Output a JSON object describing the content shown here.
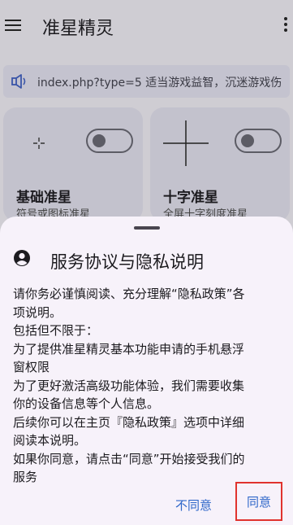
{
  "appbar": {
    "title": "准星精灵"
  },
  "banner": {
    "text": "index.php?type=5 适当游戏益智，沉迷游戏伤"
  },
  "cards": [
    {
      "title": "基础准星",
      "subtitle": "符号或图标准星"
    },
    {
      "title": "十字准星",
      "subtitle": "全屏十字刻度准星"
    }
  ],
  "dialog": {
    "title": "服务协议与隐私说明",
    "lines": [
      "请你务必谨慎阅读、充分理解“隐私政策”各",
      "项说明。",
      "包括但不限于：",
      "为了提供准星精灵基本功能申请的手机悬浮",
      "窗权限",
      "为了更好激活高级功能体验，我们需要收集",
      "你的设备信息等个人信息。",
      "后续你可以在主页『隐私政策』选项中详细",
      "阅读本说明。",
      "如果你同意，请点击“同意”开始接受我们的",
      "服务"
    ],
    "decline_label": "不同意",
    "agree_label": "同意"
  },
  "colors": {
    "accent": "#2f67c9",
    "highlight": "#e0332e",
    "sheet_bg": "#f7f2fa",
    "scrim": "#cfcdd3"
  }
}
